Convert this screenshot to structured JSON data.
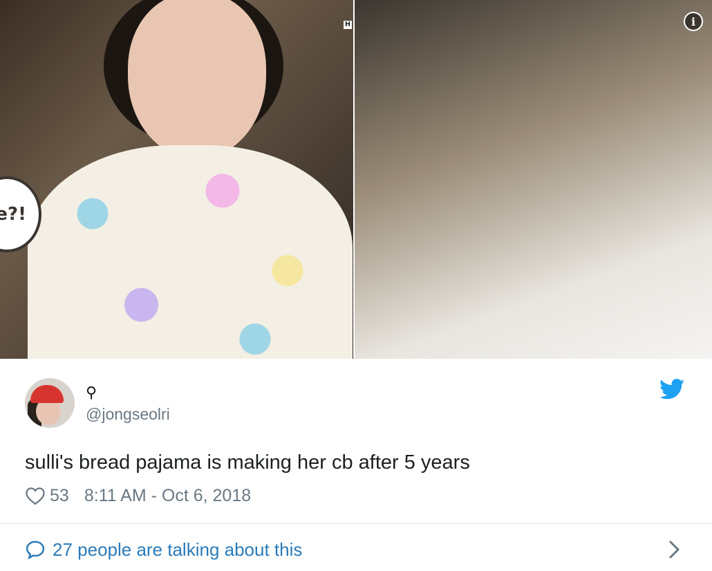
{
  "media": {
    "bubble_text": "e?!",
    "hd_badge": "H",
    "info_glyph": "i"
  },
  "author": {
    "display_name": "⚲",
    "handle": "@jongseolri",
    "avatar_icon": "avatar-photo"
  },
  "tweet": {
    "text": "sulli's bread pajama is making her cb after 5 years",
    "likes": "53",
    "timestamp": "8:11 AM - Oct 6, 2018"
  },
  "footer": {
    "talking_label": "27 people are talking about this"
  },
  "icons": {
    "brand": "twitter-bird-icon",
    "like": "heart-icon",
    "reply": "reply-bubble-icon",
    "more": "chevron-right-icon",
    "info": "info-icon"
  },
  "colors": {
    "twitter_blue": "#1da1f2",
    "link_blue": "#2b7bb9",
    "muted_text": "#697882",
    "body_text": "#1c2022",
    "divider": "#e1e8ed"
  }
}
